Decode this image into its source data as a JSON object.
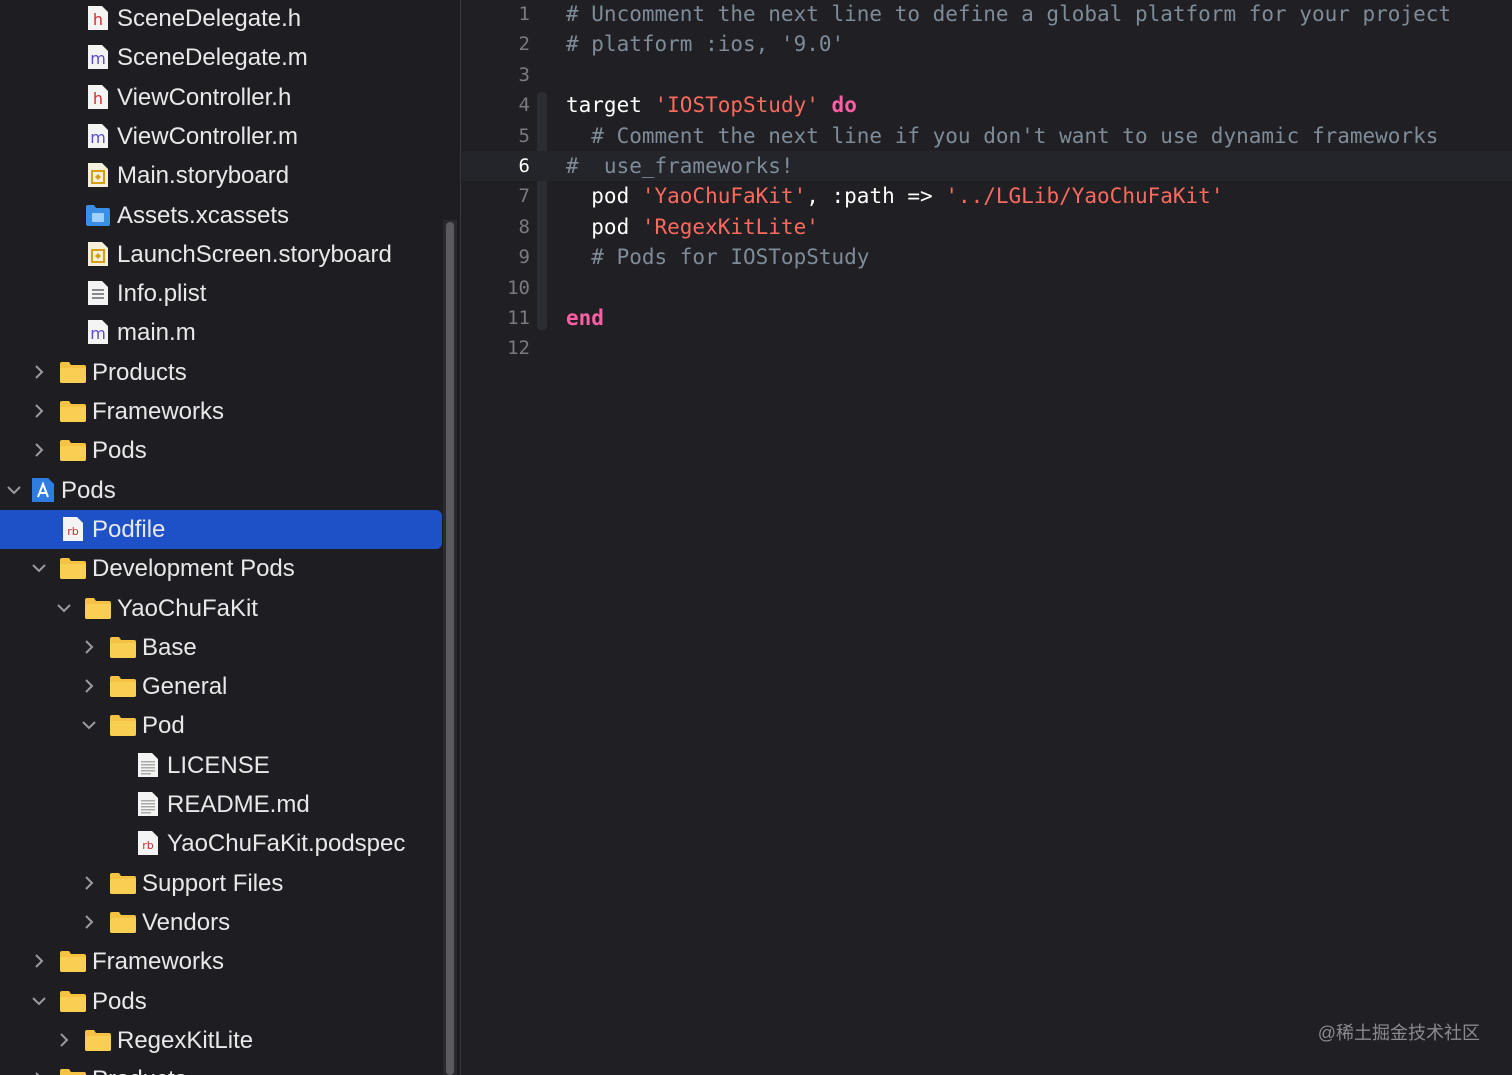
{
  "navigator": {
    "items": [
      {
        "label": "SceneDelegate.h",
        "icon": "header-file-icon",
        "indent": 3,
        "chevron": "none"
      },
      {
        "label": "SceneDelegate.m",
        "icon": "objc-file-icon",
        "indent": 3,
        "chevron": "none"
      },
      {
        "label": "ViewController.h",
        "icon": "header-file-icon",
        "indent": 3,
        "chevron": "none"
      },
      {
        "label": "ViewController.m",
        "icon": "objc-file-icon",
        "indent": 3,
        "chevron": "none"
      },
      {
        "label": "Main.storyboard",
        "icon": "storyboard-file-icon",
        "indent": 3,
        "chevron": "none"
      },
      {
        "label": "Assets.xcassets",
        "icon": "asset-catalog-icon",
        "indent": 3,
        "chevron": "none"
      },
      {
        "label": "LaunchScreen.storyboard",
        "icon": "storyboard-file-icon",
        "indent": 3,
        "chevron": "none"
      },
      {
        "label": "Info.plist",
        "icon": "plist-file-icon",
        "indent": 3,
        "chevron": "none"
      },
      {
        "label": "main.m",
        "icon": "objc-file-icon",
        "indent": 3,
        "chevron": "none"
      },
      {
        "label": "Products",
        "icon": "folder-icon",
        "indent": 2,
        "chevron": "right"
      },
      {
        "label": "Frameworks",
        "icon": "folder-icon",
        "indent": 2,
        "chevron": "right"
      },
      {
        "label": "Pods",
        "icon": "folder-icon",
        "indent": 2,
        "chevron": "right"
      },
      {
        "label": "Pods",
        "icon": "project-icon",
        "indent": 1,
        "chevron": "down"
      },
      {
        "label": "Podfile",
        "icon": "ruby-file-icon",
        "indent": 2,
        "chevron": "none",
        "selected": true
      },
      {
        "label": "Development Pods",
        "icon": "folder-icon",
        "indent": 2,
        "chevron": "down"
      },
      {
        "label": "YaoChuFaKit",
        "icon": "folder-icon",
        "indent": 3,
        "chevron": "down"
      },
      {
        "label": "Base",
        "icon": "folder-icon",
        "indent": 4,
        "chevron": "right"
      },
      {
        "label": "General",
        "icon": "folder-icon",
        "indent": 4,
        "chevron": "right"
      },
      {
        "label": "Pod",
        "icon": "folder-icon",
        "indent": 4,
        "chevron": "down"
      },
      {
        "label": "LICENSE",
        "icon": "text-file-icon",
        "indent": 5,
        "chevron": "none"
      },
      {
        "label": "README.md",
        "icon": "text-file-icon",
        "indent": 5,
        "chevron": "none"
      },
      {
        "label": "YaoChuFaKit.podspec",
        "icon": "ruby-file-icon",
        "indent": 5,
        "chevron": "none"
      },
      {
        "label": "Support Files",
        "icon": "folder-icon",
        "indent": 4,
        "chevron": "right"
      },
      {
        "label": "Vendors",
        "icon": "folder-icon",
        "indent": 4,
        "chevron": "right"
      },
      {
        "label": "Frameworks",
        "icon": "folder-icon",
        "indent": 2,
        "chevron": "right"
      },
      {
        "label": "Pods",
        "icon": "folder-icon",
        "indent": 2,
        "chevron": "down"
      },
      {
        "label": "RegexKitLite",
        "icon": "folder-icon",
        "indent": 3,
        "chevron": "right"
      },
      {
        "label": "Products",
        "icon": "folder-icon",
        "indent": 2,
        "chevron": "right"
      }
    ]
  },
  "editor": {
    "current_line": 6,
    "lines": [
      {
        "n": "1",
        "tokens": [
          {
            "t": "# Uncomment the next line to define a global platform for your project",
            "k": "comment"
          }
        ]
      },
      {
        "n": "2",
        "tokens": [
          {
            "t": "# platform :ios, '9.0'",
            "k": "comment"
          }
        ]
      },
      {
        "n": "3",
        "tokens": []
      },
      {
        "n": "4",
        "tokens": [
          {
            "t": "target ",
            "k": "plain"
          },
          {
            "t": "'IOSTopStudy'",
            "k": "string"
          },
          {
            "t": " ",
            "k": "plain"
          },
          {
            "t": "do",
            "k": "keyword"
          }
        ]
      },
      {
        "n": "5",
        "tokens": [
          {
            "t": "  # Comment the next line if you don't want to use dynamic frameworks",
            "k": "comment"
          }
        ]
      },
      {
        "n": "6",
        "tokens": [
          {
            "t": "#  use_frameworks!",
            "k": "comment"
          }
        ]
      },
      {
        "n": "7",
        "tokens": [
          {
            "t": "  pod ",
            "k": "plain"
          },
          {
            "t": "'YaoChuFaKit'",
            "k": "string"
          },
          {
            "t": ", :path => ",
            "k": "plain"
          },
          {
            "t": "'../LGLib/YaoChuFaKit'",
            "k": "string"
          }
        ]
      },
      {
        "n": "8",
        "tokens": [
          {
            "t": "  pod ",
            "k": "plain"
          },
          {
            "t": "'RegexKitLite'",
            "k": "string"
          }
        ]
      },
      {
        "n": "9",
        "tokens": [
          {
            "t": "  # Pods for IOSTopStudy",
            "k": "comment"
          }
        ]
      },
      {
        "n": "10",
        "tokens": []
      },
      {
        "n": "11",
        "tokens": [
          {
            "t": "end",
            "k": "keyword"
          }
        ]
      },
      {
        "n": "12",
        "tokens": []
      }
    ]
  },
  "watermark": "@稀土掘金技术社区",
  "colors": {
    "selection": "#1e50c8",
    "folder": "#f5c244",
    "keyword": "#fc5fa3",
    "string": "#fc6a5d",
    "comment": "#7f8c98"
  }
}
